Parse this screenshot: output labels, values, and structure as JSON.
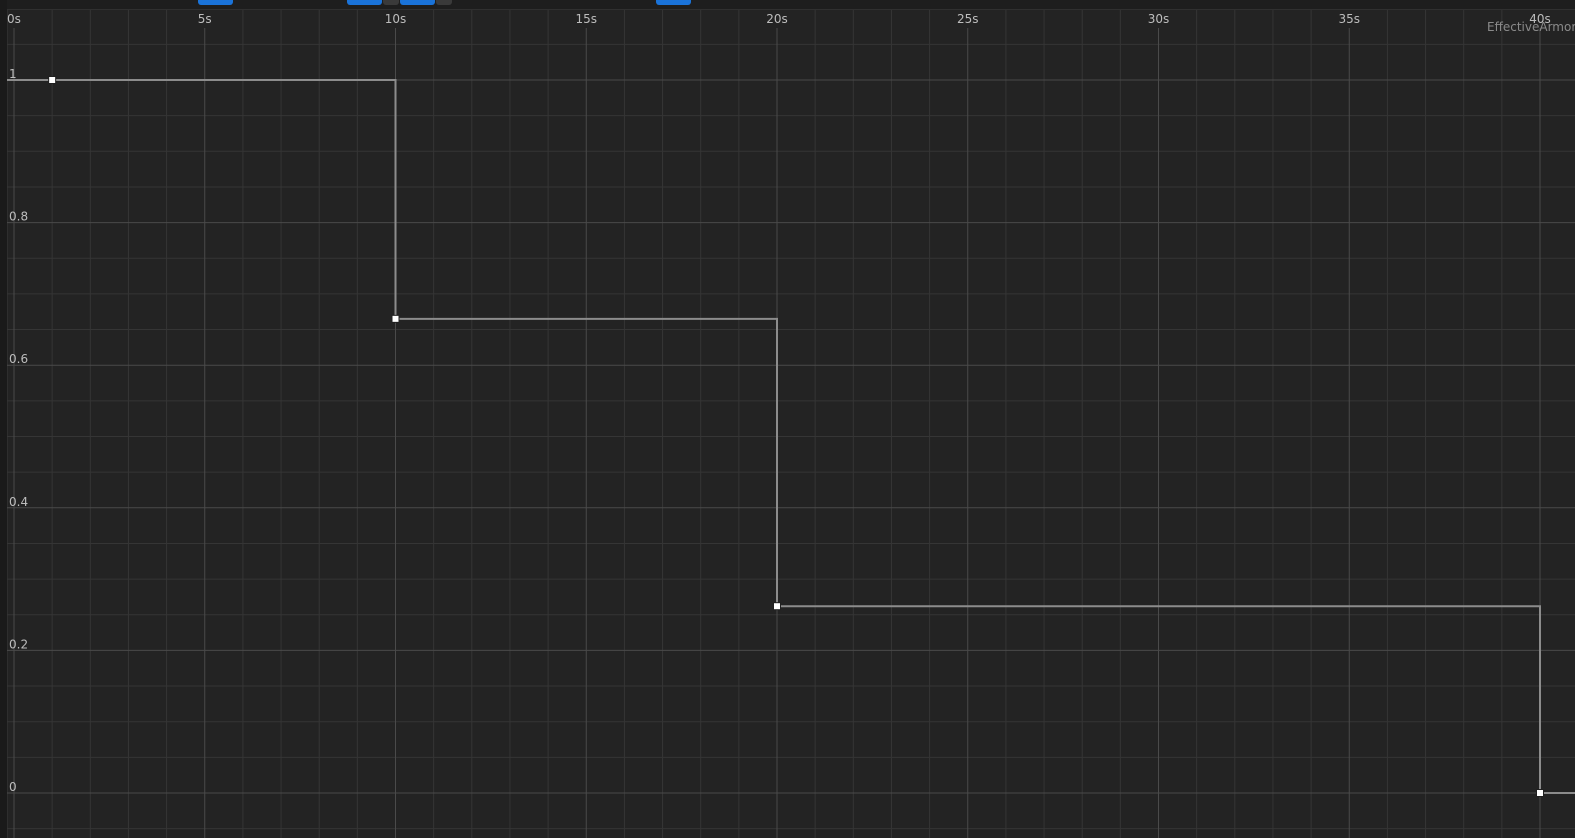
{
  "curve_editor": {
    "curve_name": "EffectiveArmor",
    "interpolation": "constant",
    "colors": {
      "background": "#232323",
      "grid_major": "#4a4a4a",
      "grid_minor": "#353535",
      "curve": "#8c8c8c",
      "key": "#ffffff",
      "accent": "#1a73d9"
    }
  },
  "chart_data": {
    "type": "line",
    "title": "",
    "xlabel": "",
    "ylabel": "",
    "xlim": [
      0,
      40.5
    ],
    "ylim": [
      -0.05,
      1.12
    ],
    "x_ticks": [
      "0s",
      "5s",
      "10s",
      "15s",
      "20s",
      "25s",
      "30s",
      "35s",
      "40s"
    ],
    "y_ticks": [
      "1",
      "0.8",
      "0.6",
      "0.4",
      "0.2",
      "0"
    ],
    "series": [
      {
        "name": "EffectiveArmor",
        "keys": [
          {
            "x": 1,
            "y": 1
          },
          {
            "x": 10,
            "y": 0.665
          },
          {
            "x": 20,
            "y": 0.262
          },
          {
            "x": 40,
            "y": 0
          }
        ]
      }
    ]
  }
}
